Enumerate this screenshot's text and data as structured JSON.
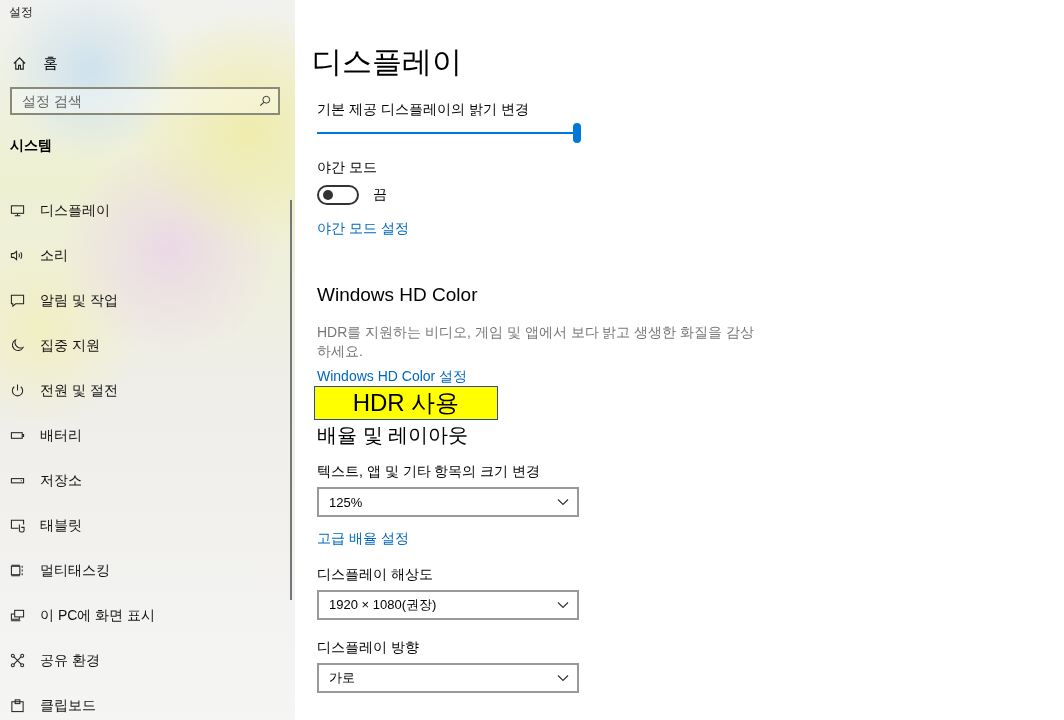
{
  "window": {
    "title": "설정"
  },
  "sidebar": {
    "home": "홈",
    "search": {
      "placeholder": "설정 검색"
    },
    "section": "시스템",
    "items": [
      {
        "label": "디스플레이",
        "selected": false
      },
      {
        "label": "소리",
        "selected": false
      },
      {
        "label": "알림 및 작업",
        "selected": false
      },
      {
        "label": "집중 지원",
        "selected": false
      },
      {
        "label": "전원 및 절전",
        "selected": false
      },
      {
        "label": "배터리",
        "selected": false
      },
      {
        "label": "저장소",
        "selected": false
      },
      {
        "label": "태블릿",
        "selected": false
      },
      {
        "label": "멀티태스킹",
        "selected": false
      },
      {
        "label": "이 PC에 화면 표시",
        "selected": false
      },
      {
        "label": "공유 환경",
        "selected": false
      },
      {
        "label": "클립보드",
        "selected": false
      }
    ]
  },
  "page": {
    "title": "디스플레이",
    "brightness": {
      "label": "기본 제공 디스플레이의 밝기 변경",
      "level": 1.0
    },
    "night_mode": {
      "label": "야간 모드",
      "on": false,
      "state_text": "끔",
      "link": "야간 모드 설정"
    },
    "hd_color": {
      "heading": "Windows HD Color",
      "description": "HDR를 지원하는 비디오, 게임 및 앱에서 보다 밝고 생생한 화질을 감상하세요.",
      "link": "Windows HD Color 설정",
      "callout": "HDR 사용"
    },
    "scale_layout": {
      "heading": "배율 및 레이아웃",
      "fields": [
        {
          "label": "텍스트, 앱 및 기타 항목의 크기 변경",
          "value": "125%",
          "link": "고급 배율 설정"
        },
        {
          "label": "디스플레이 해상도",
          "value": "1920 × 1080(권장)"
        },
        {
          "label": "디스플레이 방향",
          "value": "가로"
        }
      ]
    }
  }
}
